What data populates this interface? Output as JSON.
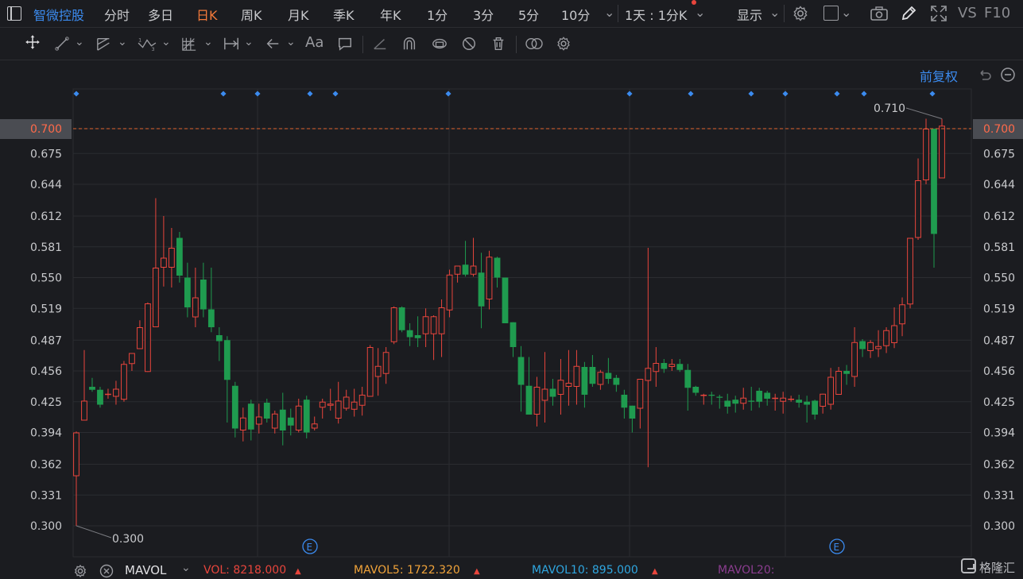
{
  "topbar": {
    "tabs": [
      "智微控股",
      "分时",
      "多日",
      "日K",
      "周K",
      "月K",
      "季K",
      "年K",
      "1分",
      "3分",
      "5分",
      "10分"
    ],
    "active_tab": "日K",
    "stock_tab": "智微控股",
    "period_select": "1天 : 1分K",
    "display_label": "显示",
    "vs_label": "VS",
    "f10_label": "F10"
  },
  "fuquan_label": "前复权",
  "bottom": {
    "indicator": "MAVOL",
    "vol_label": "VOL: 8218.000",
    "mavol5_label": "MAVOL5: 1722.320",
    "mavol10_label": "MAVOL10: 895.000",
    "mavol20_label": "MAVOL20:",
    "brand": "格隆汇"
  },
  "colors": {
    "up": "#e8453c",
    "down": "#1f9b4f",
    "grid": "#2b2c31",
    "axis_text": "#c8c9cc",
    "current_price_line": "#e0652e",
    "accent_blue": "#3b8bef",
    "mavol5": "#f0a33a",
    "mavol10": "#2fa6e0",
    "mavol20": "#8b3d8f"
  },
  "chart_data": {
    "type": "candlestick",
    "y_ticks": [
      "0.700",
      "0.675",
      "0.644",
      "0.612",
      "0.581",
      "0.550",
      "0.519",
      "0.487",
      "0.456",
      "0.425",
      "0.394",
      "0.362",
      "0.331",
      "0.300"
    ],
    "ylim": [
      0.292,
      0.7203
    ],
    "current_price_label": "0.700",
    "high_label": "0.710",
    "low_label": "0.300",
    "event_markers": [
      "E",
      "E"
    ],
    "candles": [
      {
        "o": 0.35,
        "h": 0.395,
        "l": 0.3,
        "c": 0.394
      },
      {
        "o": 0.406,
        "h": 0.477,
        "l": 0.406,
        "c": 0.426
      },
      {
        "o": 0.44,
        "h": 0.449,
        "l": 0.435,
        "c": 0.437
      },
      {
        "o": 0.437,
        "h": 0.44,
        "l": 0.419,
        "c": 0.422
      },
      {
        "o": 0.432,
        "h": 0.438,
        "l": 0.428,
        "c": 0.433
      },
      {
        "o": 0.43,
        "h": 0.446,
        "l": 0.422,
        "c": 0.438
      },
      {
        "o": 0.427,
        "h": 0.466,
        "l": 0.425,
        "c": 0.463
      },
      {
        "o": 0.463,
        "h": 0.474,
        "l": 0.456,
        "c": 0.474
      },
      {
        "o": 0.478,
        "h": 0.507,
        "l": 0.478,
        "c": 0.5
      },
      {
        "o": 0.455,
        "h": 0.525,
        "l": 0.455,
        "c": 0.524
      },
      {
        "o": 0.5,
        "h": 0.63,
        "l": 0.5,
        "c": 0.56
      },
      {
        "o": 0.56,
        "h": 0.612,
        "l": 0.541,
        "c": 0.57
      },
      {
        "o": 0.56,
        "h": 0.6,
        "l": 0.54,
        "c": 0.58
      },
      {
        "o": 0.59,
        "h": 0.596,
        "l": 0.545,
        "c": 0.552
      },
      {
        "o": 0.55,
        "h": 0.565,
        "l": 0.51,
        "c": 0.52
      },
      {
        "o": 0.51,
        "h": 0.56,
        "l": 0.5,
        "c": 0.53
      },
      {
        "o": 0.548,
        "h": 0.565,
        "l": 0.51,
        "c": 0.518
      },
      {
        "o": 0.518,
        "h": 0.56,
        "l": 0.495,
        "c": 0.5
      },
      {
        "o": 0.492,
        "h": 0.5,
        "l": 0.466,
        "c": 0.486
      },
      {
        "o": 0.487,
        "h": 0.491,
        "l": 0.404,
        "c": 0.447
      },
      {
        "o": 0.441,
        "h": 0.445,
        "l": 0.389,
        "c": 0.398
      },
      {
        "o": 0.396,
        "h": 0.419,
        "l": 0.385,
        "c": 0.409
      },
      {
        "o": 0.423,
        "h": 0.427,
        "l": 0.386,
        "c": 0.397
      },
      {
        "o": 0.402,
        "h": 0.423,
        "l": 0.393,
        "c": 0.41
      },
      {
        "o": 0.424,
        "h": 0.428,
        "l": 0.404,
        "c": 0.408
      },
      {
        "o": 0.398,
        "h": 0.416,
        "l": 0.393,
        "c": 0.413
      },
      {
        "o": 0.417,
        "h": 0.434,
        "l": 0.381,
        "c": 0.396
      },
      {
        "o": 0.409,
        "h": 0.418,
        "l": 0.391,
        "c": 0.401
      },
      {
        "o": 0.396,
        "h": 0.428,
        "l": 0.394,
        "c": 0.421
      },
      {
        "o": 0.427,
        "h": 0.431,
        "l": 0.388,
        "c": 0.394
      },
      {
        "o": 0.398,
        "h": 0.41,
        "l": 0.396,
        "c": 0.403
      },
      {
        "o": 0.419,
        "h": 0.428,
        "l": 0.408,
        "c": 0.425
      },
      {
        "o": 0.421,
        "h": 0.438,
        "l": 0.416,
        "c": 0.423
      },
      {
        "o": 0.408,
        "h": 0.445,
        "l": 0.403,
        "c": 0.426
      },
      {
        "o": 0.418,
        "h": 0.437,
        "l": 0.416,
        "c": 0.43
      },
      {
        "o": 0.417,
        "h": 0.438,
        "l": 0.41,
        "c": 0.425
      },
      {
        "o": 0.421,
        "h": 0.44,
        "l": 0.411,
        "c": 0.432
      },
      {
        "o": 0.43,
        "h": 0.482,
        "l": 0.43,
        "c": 0.48
      },
      {
        "o": 0.45,
        "h": 0.479,
        "l": 0.431,
        "c": 0.461
      },
      {
        "o": 0.453,
        "h": 0.48,
        "l": 0.443,
        "c": 0.475
      },
      {
        "o": 0.485,
        "h": 0.521,
        "l": 0.483,
        "c": 0.52
      },
      {
        "o": 0.52,
        "h": 0.521,
        "l": 0.495,
        "c": 0.497
      },
      {
        "o": 0.497,
        "h": 0.504,
        "l": 0.481,
        "c": 0.49
      },
      {
        "o": 0.492,
        "h": 0.511,
        "l": 0.48,
        "c": 0.489
      },
      {
        "o": 0.493,
        "h": 0.519,
        "l": 0.48,
        "c": 0.511
      },
      {
        "o": 0.493,
        "h": 0.512,
        "l": 0.467,
        "c": 0.511
      },
      {
        "o": 0.493,
        "h": 0.528,
        "l": 0.47,
        "c": 0.52
      },
      {
        "o": 0.517,
        "h": 0.558,
        "l": 0.51,
        "c": 0.553
      },
      {
        "o": 0.553,
        "h": 0.562,
        "l": 0.545,
        "c": 0.562
      },
      {
        "o": 0.563,
        "h": 0.587,
        "l": 0.551,
        "c": 0.553
      },
      {
        "o": 0.553,
        "h": 0.59,
        "l": 0.551,
        "c": 0.562
      },
      {
        "o": 0.555,
        "h": 0.575,
        "l": 0.499,
        "c": 0.521
      },
      {
        "o": 0.528,
        "h": 0.577,
        "l": 0.518,
        "c": 0.571
      },
      {
        "o": 0.57,
        "h": 0.571,
        "l": 0.54,
        "c": 0.55
      },
      {
        "o": 0.55,
        "h": 0.532,
        "l": 0.506,
        "c": 0.504
      },
      {
        "o": 0.505,
        "h": 0.505,
        "l": 0.47,
        "c": 0.48
      },
      {
        "o": 0.47,
        "h": 0.481,
        "l": 0.415,
        "c": 0.442
      },
      {
        "o": 0.441,
        "h": 0.47,
        "l": 0.414,
        "c": 0.412
      },
      {
        "o": 0.412,
        "h": 0.45,
        "l": 0.4,
        "c": 0.44
      },
      {
        "o": 0.426,
        "h": 0.475,
        "l": 0.404,
        "c": 0.438
      },
      {
        "o": 0.438,
        "h": 0.448,
        "l": 0.421,
        "c": 0.43
      },
      {
        "o": 0.432,
        "h": 0.468,
        "l": 0.412,
        "c": 0.447
      },
      {
        "o": 0.44,
        "h": 0.477,
        "l": 0.421,
        "c": 0.444
      },
      {
        "o": 0.44,
        "h": 0.477,
        "l": 0.422,
        "c": 0.461
      },
      {
        "o": 0.46,
        "h": 0.465,
        "l": 0.419,
        "c": 0.432
      },
      {
        "o": 0.46,
        "h": 0.472,
        "l": 0.44,
        "c": 0.443
      },
      {
        "o": 0.442,
        "h": 0.457,
        "l": 0.437,
        "c": 0.455
      },
      {
        "o": 0.454,
        "h": 0.469,
        "l": 0.443,
        "c": 0.448
      },
      {
        "o": 0.449,
        "h": 0.452,
        "l": 0.435,
        "c": 0.442
      },
      {
        "o": 0.432,
        "h": 0.437,
        "l": 0.408,
        "c": 0.419
      },
      {
        "o": 0.421,
        "h": 0.421,
        "l": 0.394,
        "c": 0.408
      },
      {
        "o": 0.418,
        "h": 0.447,
        "l": 0.398,
        "c": 0.448
      },
      {
        "o": 0.446,
        "h": 0.58,
        "l": 0.359,
        "c": 0.459
      },
      {
        "o": 0.455,
        "h": 0.48,
        "l": 0.44,
        "c": 0.464
      },
      {
        "o": 0.464,
        "h": 0.468,
        "l": 0.454,
        "c": 0.458
      },
      {
        "o": 0.46,
        "h": 0.468,
        "l": 0.456,
        "c": 0.463
      },
      {
        "o": 0.463,
        "h": 0.468,
        "l": 0.455,
        "c": 0.457
      },
      {
        "o": 0.457,
        "h": 0.463,
        "l": 0.416,
        "c": 0.439
      },
      {
        "o": 0.44,
        "h": 0.441,
        "l": 0.431,
        "c": 0.434
      },
      {
        "o": 0.431,
        "h": 0.433,
        "l": 0.422,
        "c": 0.432
      },
      {
        "o": 0.432,
        "h": 0.435,
        "l": 0.422,
        "c": 0.431
      },
      {
        "o": 0.43,
        "h": 0.432,
        "l": 0.418,
        "c": 0.429
      },
      {
        "o": 0.426,
        "h": 0.433,
        "l": 0.413,
        "c": 0.42
      },
      {
        "o": 0.427,
        "h": 0.431,
        "l": 0.414,
        "c": 0.423
      },
      {
        "o": 0.423,
        "h": 0.439,
        "l": 0.417,
        "c": 0.429
      },
      {
        "o": 0.426,
        "h": 0.44,
        "l": 0.416,
        "c": 0.425
      },
      {
        "o": 0.436,
        "h": 0.439,
        "l": 0.419,
        "c": 0.425
      },
      {
        "o": 0.434,
        "h": 0.436,
        "l": 0.421,
        "c": 0.428
      },
      {
        "o": 0.428,
        "h": 0.433,
        "l": 0.416,
        "c": 0.429
      },
      {
        "o": 0.425,
        "h": 0.435,
        "l": 0.413,
        "c": 0.429
      },
      {
        "o": 0.427,
        "h": 0.431,
        "l": 0.425,
        "c": 0.428
      },
      {
        "o": 0.427,
        "h": 0.432,
        "l": 0.419,
        "c": 0.424
      },
      {
        "o": 0.425,
        "h": 0.431,
        "l": 0.404,
        "c": 0.422
      },
      {
        "o": 0.426,
        "h": 0.427,
        "l": 0.407,
        "c": 0.412
      },
      {
        "o": 0.42,
        "h": 0.432,
        "l": 0.413,
        "c": 0.433
      },
      {
        "o": 0.422,
        "h": 0.459,
        "l": 0.417,
        "c": 0.45
      },
      {
        "o": 0.432,
        "h": 0.46,
        "l": 0.432,
        "c": 0.456
      },
      {
        "o": 0.456,
        "h": 0.462,
        "l": 0.442,
        "c": 0.453
      },
      {
        "o": 0.45,
        "h": 0.5,
        "l": 0.44,
        "c": 0.485
      },
      {
        "o": 0.486,
        "h": 0.488,
        "l": 0.47,
        "c": 0.478
      },
      {
        "o": 0.476,
        "h": 0.487,
        "l": 0.469,
        "c": 0.485
      },
      {
        "o": 0.478,
        "h": 0.497,
        "l": 0.47,
        "c": 0.481
      },
      {
        "o": 0.481,
        "h": 0.5,
        "l": 0.474,
        "c": 0.497
      },
      {
        "o": 0.484,
        "h": 0.52,
        "l": 0.479,
        "c": 0.502
      },
      {
        "o": 0.503,
        "h": 0.53,
        "l": 0.491,
        "c": 0.523
      },
      {
        "o": 0.523,
        "h": 0.585,
        "l": 0.519,
        "c": 0.59
      },
      {
        "o": 0.59,
        "h": 0.67,
        "l": 0.588,
        "c": 0.648
      },
      {
        "o": 0.648,
        "h": 0.71,
        "l": 0.644,
        "c": 0.7
      },
      {
        "o": 0.7,
        "h": 0.7,
        "l": 0.56,
        "c": 0.594
      },
      {
        "o": 0.65,
        "h": 0.71,
        "l": 0.65,
        "c": 0.703
      }
    ]
  }
}
